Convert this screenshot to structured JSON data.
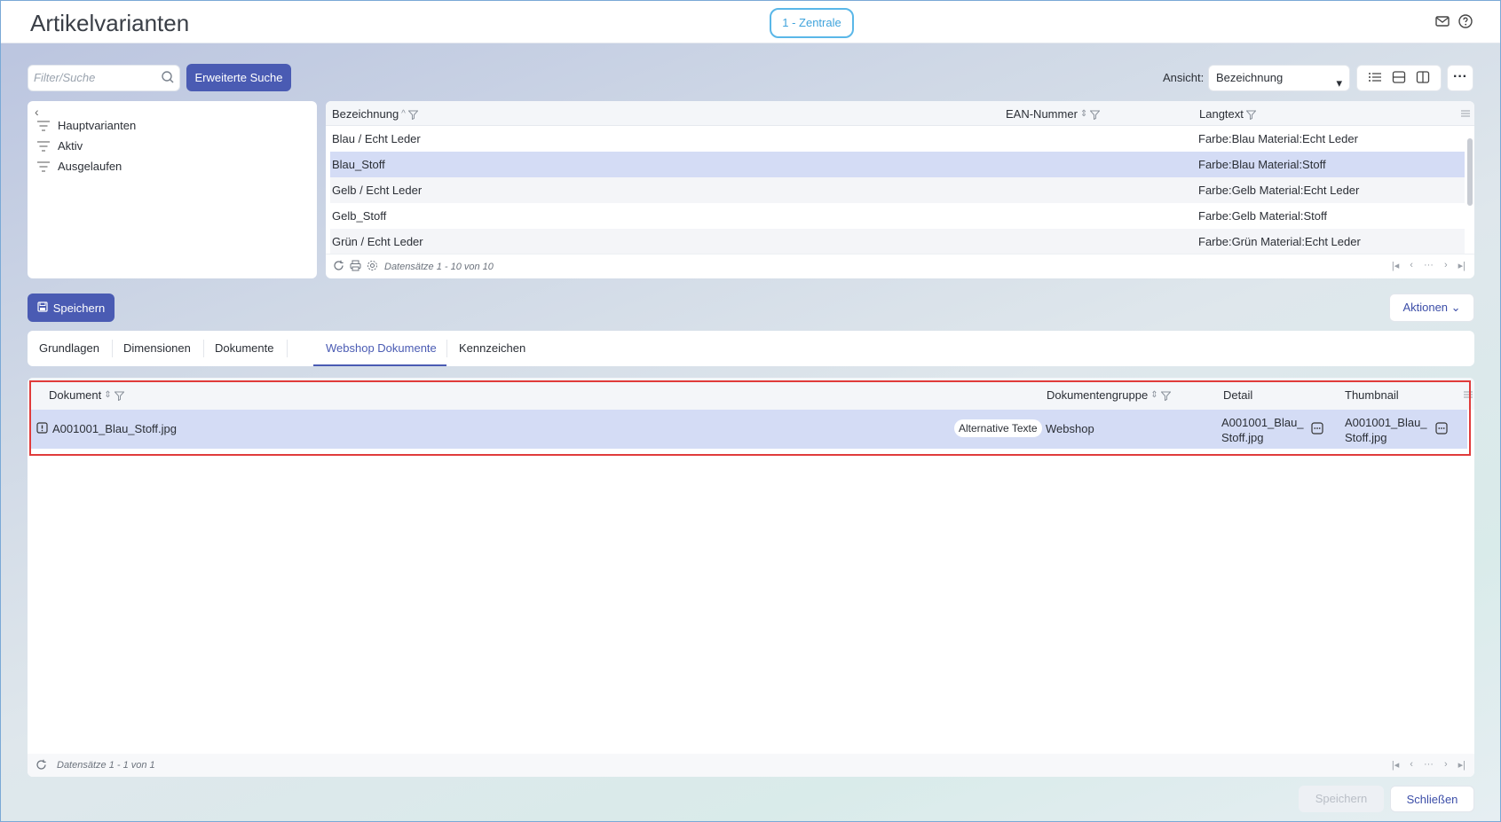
{
  "window": {
    "title": "Artikelvarianten",
    "branch": "1 - Zentrale"
  },
  "search": {
    "placeholder": "Filter/Suche",
    "advanced_button": "Erweiterte Suche"
  },
  "view": {
    "label": "Ansicht:",
    "selected": "Bezeichnung"
  },
  "filters": [
    {
      "label": "Hauptvarianten"
    },
    {
      "label": "Aktiv"
    },
    {
      "label": "Ausgelaufen"
    }
  ],
  "grid": {
    "columns": [
      "Bezeichnung",
      "EAN-Nummer",
      "Langtext"
    ],
    "rows": [
      {
        "bezeichnung": "Blau / Echt Leder",
        "ean": "",
        "langtext": "Farbe:Blau Material:Echt Leder"
      },
      {
        "bezeichnung": "Blau_Stoff",
        "ean": "",
        "langtext": "Farbe:Blau Material:Stoff"
      },
      {
        "bezeichnung": "Gelb / Echt Leder",
        "ean": "",
        "langtext": "Farbe:Gelb Material:Echt Leder"
      },
      {
        "bezeichnung": "Gelb_Stoff",
        "ean": "",
        "langtext": "Farbe:Gelb Material:Stoff"
      },
      {
        "bezeichnung": "Grün / Echt Leder",
        "ean": "",
        "langtext": "Farbe:Grün Material:Echt Leder"
      }
    ],
    "footer": "Datensätze 1 - 10 von 10"
  },
  "actions": {
    "save": "Speichern",
    "aktionen": "Aktionen"
  },
  "tabs": [
    {
      "label": "Grundlagen"
    },
    {
      "label": "Dimensionen"
    },
    {
      "label": "Dokumente"
    },
    {
      "label": "Webshop Dokumente"
    },
    {
      "label": "Kennzeichen"
    }
  ],
  "documents": {
    "columns": [
      "Dokument",
      "Dokumentengruppe",
      "Detail",
      "Thumbnail"
    ],
    "rows": [
      {
        "dokument": "A001001_Blau_Stoff.jpg",
        "alt_text_badge": "Alternative Texte",
        "gruppe": "Webshop",
        "detail": "A001001_Blau_Stoff.jpg",
        "thumbnail": "A001001_Blau_Stoff.jpg"
      }
    ],
    "footer": "Datensätze 1 - 1 von 1"
  },
  "footer": {
    "save": "Speichern",
    "close": "Schließen"
  },
  "colors": {
    "accent": "#4a5bb3",
    "selection": "#d4dcf5",
    "highlight": "#e03b3b",
    "branch": "#5ab7e8"
  }
}
